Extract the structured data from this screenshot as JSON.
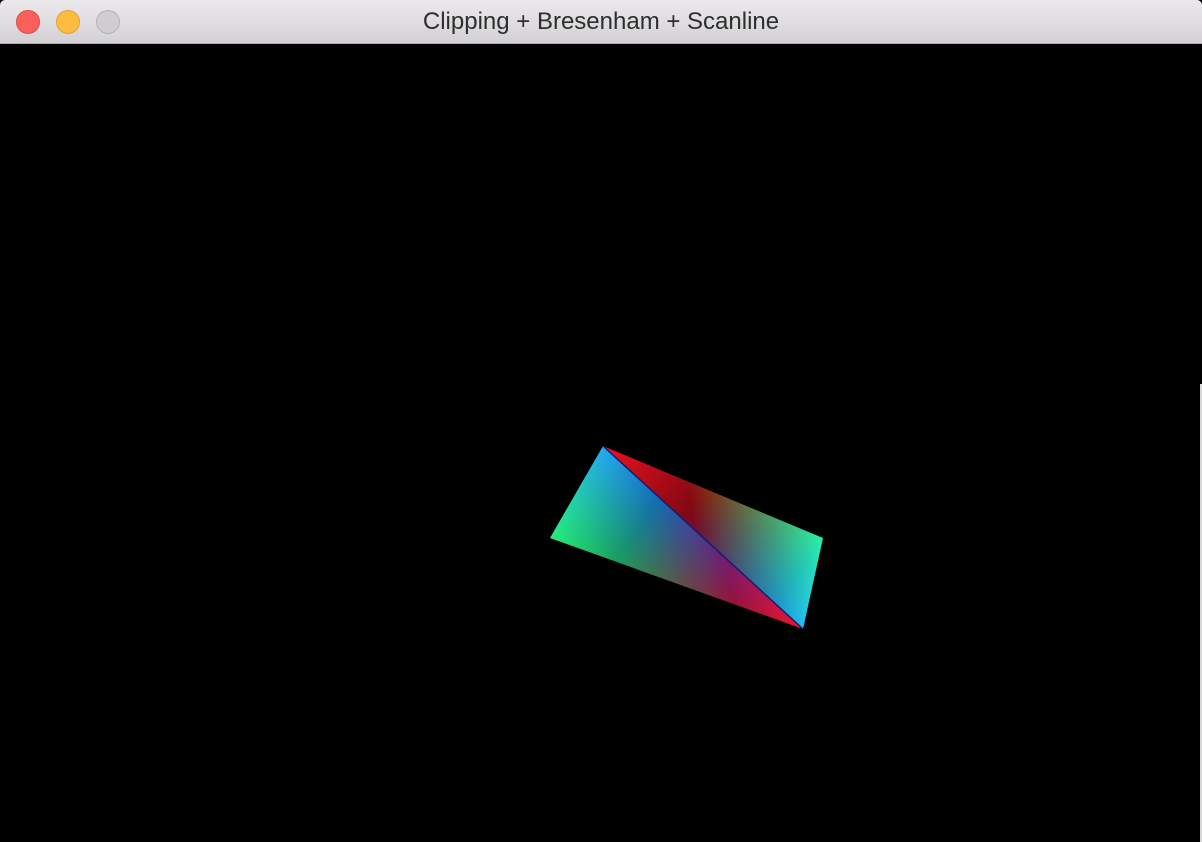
{
  "window": {
    "title": "Clipping + Bresenham + Scanline",
    "controls": {
      "close_color": "#fc605b",
      "minimize_color": "#fdbc40",
      "zoom_color": "#cfcdd0"
    }
  },
  "scene": {
    "background": "#000000",
    "shape": "quadrilateral split into two gouraud-shaded triangles",
    "vertex_colors": {
      "top": "#1030f0",
      "left": "#20f030",
      "right": "#20f030",
      "bottom": "#f01020",
      "top_alt": "#f01020",
      "bottom_alt": "#1030f0"
    }
  }
}
